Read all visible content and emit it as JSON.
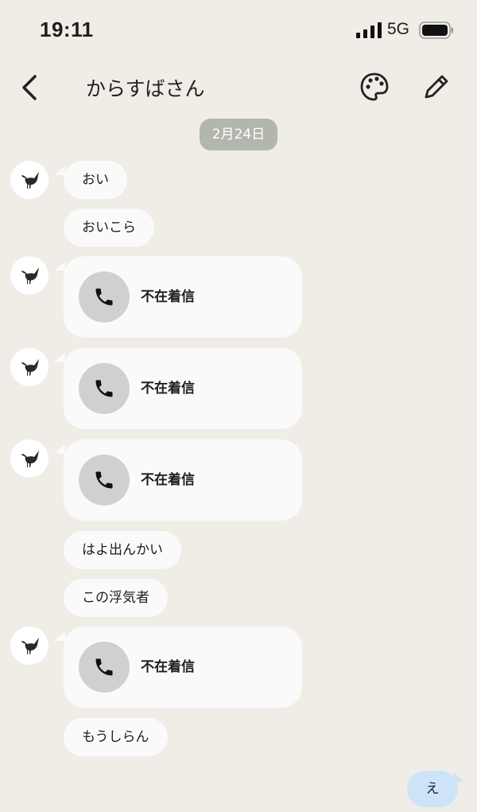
{
  "status_bar": {
    "time": "19:11",
    "network": "5G"
  },
  "header": {
    "title": "からすばさん"
  },
  "date_separator": "2月24日",
  "messages": [
    {
      "type": "text",
      "text": "おい",
      "show_avatar": true
    },
    {
      "type": "text",
      "text": "おいこら",
      "show_avatar": false
    },
    {
      "type": "call",
      "text": "不在着信",
      "show_avatar": true
    },
    {
      "type": "call",
      "text": "不在着信",
      "show_avatar": true
    },
    {
      "type": "call",
      "text": "不在着信",
      "show_avatar": true
    },
    {
      "type": "text",
      "text": "はよ出んかい",
      "show_avatar": false
    },
    {
      "type": "text",
      "text": "この浮気者",
      "show_avatar": false
    },
    {
      "type": "call",
      "text": "不在着信",
      "show_avatar": true
    },
    {
      "type": "text",
      "text": "もうしらん",
      "show_avatar": false
    }
  ],
  "sent_message": {
    "text": "え"
  },
  "icons": {
    "back": "chevron-left-icon",
    "palette": "palette-icon",
    "edit": "pencil-icon",
    "avatar": "crow-icon",
    "call": "phone-icon"
  },
  "colors": {
    "background": "#efede6",
    "bubble": "#fafafa",
    "date_pill": "#b3b6ad",
    "sent_bubble": "#cde4f8",
    "call_circle": "#d0d0d0"
  }
}
